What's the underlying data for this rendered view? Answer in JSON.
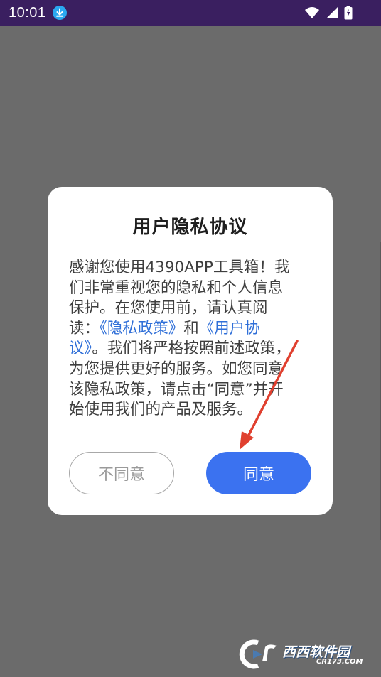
{
  "status_bar": {
    "time": "10:01",
    "icons": [
      "download-icon",
      "wifi-icon",
      "signal-icon",
      "battery-charging-icon"
    ]
  },
  "dialog": {
    "title": "用户隐私协议",
    "body_before": "感谢您使用4390APP工具箱！我们非常重视您的隐私和个人信息保护。在您使用前，请认真阅读：",
    "link_privacy": "《隐私政策》",
    "body_and": "和",
    "link_user_agreement": "《用户协议》",
    "body_after": "。我们将严格按照前述政策，为您提供更好的服务。如您同意该隐私政策，请点击“同意”并开始使用我们的产品及服务。",
    "disagree_label": "不同意",
    "agree_label": "同意"
  },
  "watermark": {
    "text": "西西软件园",
    "domain": "CR173.COM"
  },
  "colors": {
    "overlay": "#6b6b6b",
    "status_bar": "#3a1f60",
    "accent": "#3b72f0",
    "link": "#2f6fd8",
    "arrow": "#e0402f"
  }
}
